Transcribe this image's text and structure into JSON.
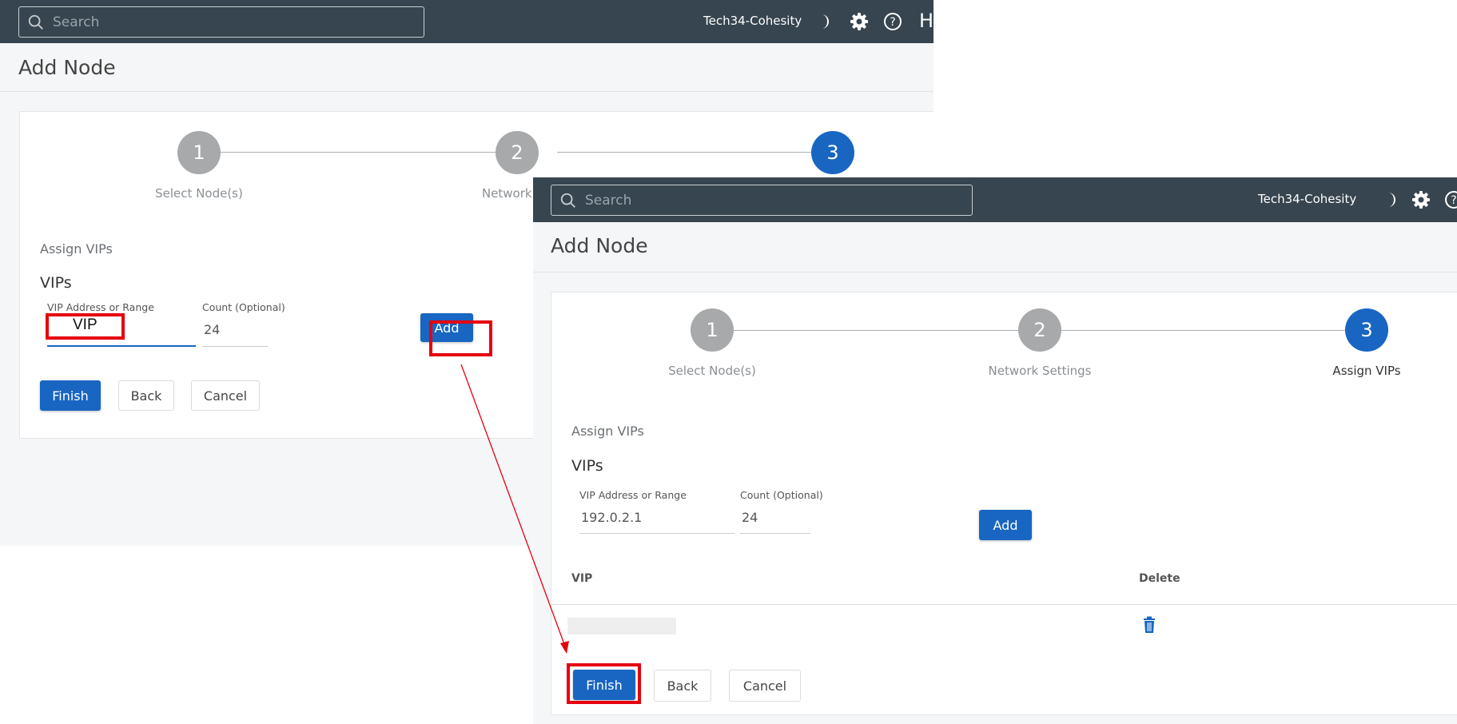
{
  "shot1": {
    "search": {
      "placeholder": "Search"
    },
    "cluster_name": "Tech34-Cohesity",
    "header_icons": [
      "moon-icon",
      "gear-icon",
      "help-icon"
    ],
    "header_cut_text": "H",
    "page_title": "Add Node",
    "steps": [
      {
        "number": "1",
        "label": "Select Node(s)",
        "state": "done"
      },
      {
        "number": "2",
        "label": "Network Se",
        "state": "done"
      },
      {
        "number": "3",
        "label": "",
        "state": "active"
      }
    ],
    "section_label": "Assign VIPs",
    "vips_heading": "VIPs",
    "vip_field": {
      "label": "VIP Address or Range",
      "typed_value": "VIP"
    },
    "count_field": {
      "label": "Count (Optional)",
      "value": "24"
    },
    "add_button": "Add",
    "finish_button": "Finish",
    "back_button": "Back",
    "cancel_button": "Cancel"
  },
  "shot2": {
    "search": {
      "placeholder": "Search"
    },
    "cluster_name": "Tech34-Cohesity",
    "header_icons": [
      "moon-icon",
      "gear-icon",
      "help-icon"
    ],
    "page_title": "Add Node",
    "steps": [
      {
        "number": "1",
        "label": "Select Node(s)",
        "state": "done"
      },
      {
        "number": "2",
        "label": "Network Settings",
        "state": "done"
      },
      {
        "number": "3",
        "label": "Assign VIPs",
        "state": "active"
      }
    ],
    "section_label": "Assign VIPs",
    "vips_heading": "VIPs",
    "vip_field": {
      "label": "VIP Address or Range",
      "value": "192.0.2.1"
    },
    "count_field": {
      "label": "Count (Optional)",
      "value": "24"
    },
    "add_button": "Add",
    "table": {
      "headers": [
        "VIP",
        "Delete"
      ],
      "rows": [
        {
          "vip": "",
          "delete_icon": "trash-icon"
        }
      ]
    },
    "finish_button": "Finish",
    "back_button": "Back",
    "cancel_button": "Cancel"
  },
  "annotations": {
    "highlight_color": "#e5000f",
    "arrow_color": "#e5000f"
  },
  "colors": {
    "topbar": "#36454f",
    "primary": "#1866c2",
    "step_done": "#a7a9ab"
  }
}
